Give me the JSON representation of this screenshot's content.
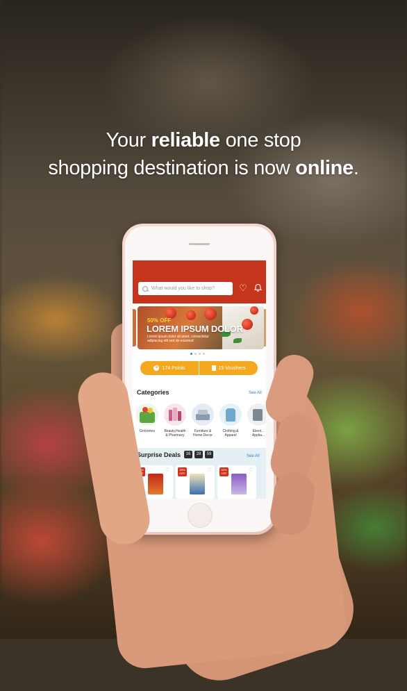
{
  "headline": {
    "line1_pre": "Your ",
    "line1_bold": "reliable",
    "line1_post": " one stop",
    "line2_pre": "shopping destination is now ",
    "line2_bold": "online",
    "line2_post": "."
  },
  "app": {
    "search_placeholder": "What would you like to shop?",
    "banner": {
      "discount": "50% OFF",
      "title": "LOREM IPSUM DOLOR",
      "subtitle": "Lorem ipsum dolor sit amet, consectetur adipiscing elit sed do eiusmod"
    },
    "points_label": "174 Points",
    "vouchers_label": "15 Vouchers",
    "categories": {
      "title": "Categories",
      "see_all": "See All",
      "items": [
        {
          "label": "Groceries"
        },
        {
          "label": "Beauty,Health & Pharmacy"
        },
        {
          "label": "Furniture & Home Decor"
        },
        {
          "label": "Clothing & Apparel"
        },
        {
          "label": "Electr... Applia..."
        }
      ]
    },
    "surprise_deals": {
      "title": "Surprise Deals",
      "timer": [
        "16",
        "28",
        "59"
      ],
      "see_all": "See All",
      "products": [
        {
          "tag": "50% OFF"
        },
        {
          "tag": "50% OFF"
        },
        {
          "tag": "50% OFF"
        }
      ]
    }
  },
  "colors": {
    "brand_red": "#c5341d",
    "points_orange": "#f3a81e",
    "link_blue": "#2e80d6"
  }
}
